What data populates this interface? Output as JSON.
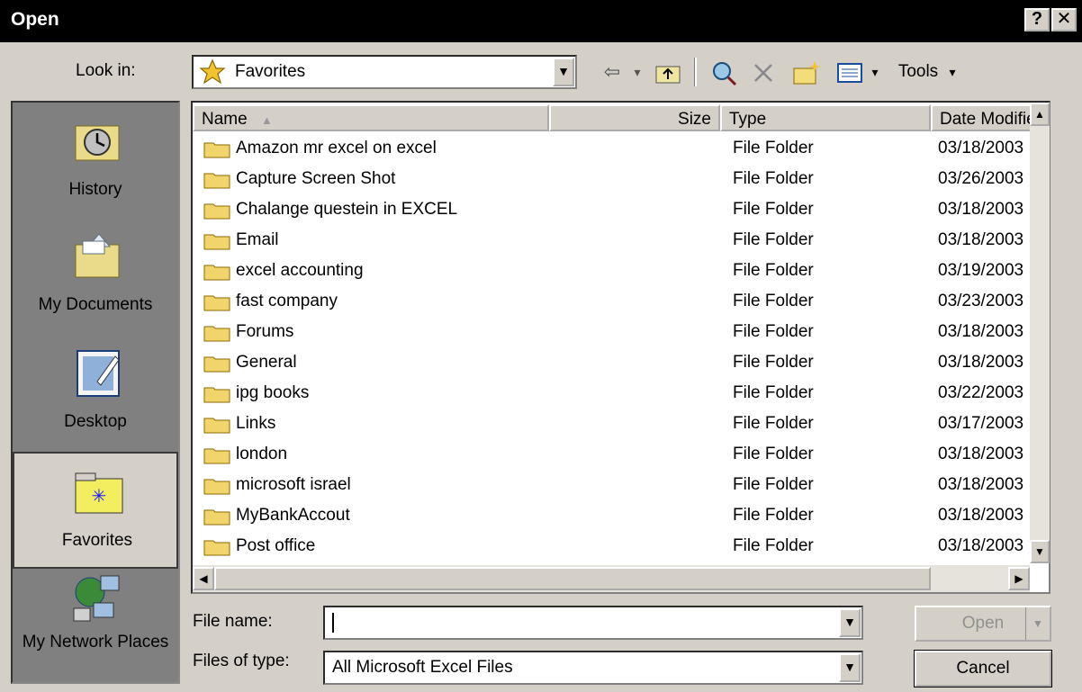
{
  "window": {
    "title": "Open",
    "help_label": "?",
    "close_label": "✕"
  },
  "look_in": {
    "label": "Look in:",
    "value": "Favorites"
  },
  "toolbar": {
    "back_label": "⇦",
    "tools_label": "Tools"
  },
  "places": [
    {
      "label": "History"
    },
    {
      "label": "My Documents"
    },
    {
      "label": "Desktop"
    },
    {
      "label": "Favorites"
    },
    {
      "label": "My Network Places"
    }
  ],
  "columns": {
    "name": "Name",
    "size": "Size",
    "type": "Type",
    "date": "Date Modified"
  },
  "files": [
    {
      "name": "Amazon mr excel on excel",
      "type": "File Folder",
      "date": "03/18/2003"
    },
    {
      "name": "Capture Screen Shot",
      "type": "File Folder",
      "date": "03/26/2003"
    },
    {
      "name": "Chalange questein in EXCEL",
      "type": "File Folder",
      "date": "03/18/2003"
    },
    {
      "name": "Email",
      "type": "File Folder",
      "date": "03/18/2003"
    },
    {
      "name": "excel accounting",
      "type": "File Folder",
      "date": "03/19/2003"
    },
    {
      "name": "fast company",
      "type": "File Folder",
      "date": "03/23/2003"
    },
    {
      "name": "Forums",
      "type": "File Folder",
      "date": "03/18/2003"
    },
    {
      "name": "General",
      "type": "File Folder",
      "date": "03/18/2003"
    },
    {
      "name": "ipg books",
      "type": "File Folder",
      "date": "03/22/2003"
    },
    {
      "name": "Links",
      "type": "File Folder",
      "date": "03/17/2003"
    },
    {
      "name": "london",
      "type": "File Folder",
      "date": "03/18/2003"
    },
    {
      "name": "microsoft israel",
      "type": "File Folder",
      "date": "03/18/2003"
    },
    {
      "name": "MyBankAccout",
      "type": "File Folder",
      "date": "03/18/2003"
    },
    {
      "name": "Post office",
      "type": "File Folder",
      "date": "03/18/2003"
    }
  ],
  "file_name": {
    "label": "File name:",
    "value": ""
  },
  "file_type": {
    "label": "Files of type:",
    "value": "All Microsoft Excel Files"
  },
  "buttons": {
    "open": "Open",
    "cancel": "Cancel"
  }
}
